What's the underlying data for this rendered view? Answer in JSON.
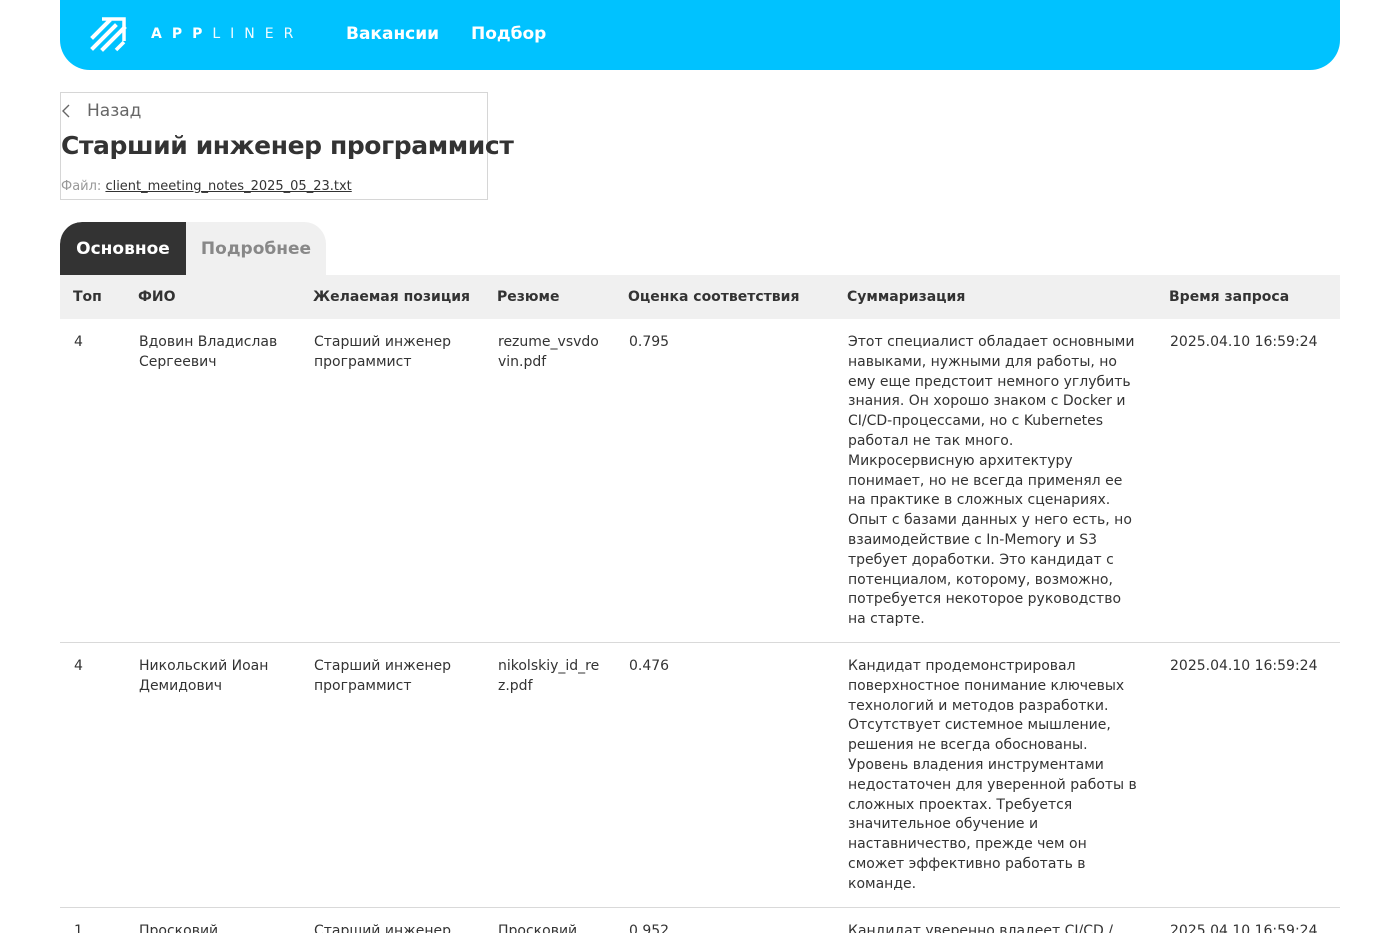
{
  "header": {
    "brand_bold": "APP",
    "brand_light": "LINER",
    "nav": [
      "Вакансии",
      "Подбор"
    ]
  },
  "page": {
    "back_label": "Назад",
    "title": "Старший инженер программист",
    "file_label": "Файл:",
    "file_name": "client_meeting_notes_2025_05_23.txt"
  },
  "tabs": [
    "Основное",
    "Подробнее"
  ],
  "colors": {
    "accent": "#00c2ff",
    "active_tab": "#333333",
    "header_bg": "#f0f0f0"
  },
  "table": {
    "columns": [
      "Топ",
      "ФИО",
      "Желаемая позиция",
      "Резюме",
      "Оценка соответствия",
      "Суммаризация",
      "Время запроса"
    ],
    "rows": [
      {
        "top": "4",
        "name": "Вдовин Владислав Сергеевич",
        "position": "Старший инженер программист",
        "resume": "rezume_vsvdovin.pdf",
        "score": "0.795",
        "summary": "Этот специалист обладает основными навыками, нужными для работы, но ему еще предстоит немного углубить знания. Он хорошо знаком с Docker и CI/CD-процессами, но с Kubernetes работал не так много. Микросервисную архитектуру понимает, но не всегда применял ее на практике в сложных сценариях. Опыт с базами данных у него есть, но взаимодействие с In-Memory и S3 требует доработки. Это кандидат с потенциалом, которому, возможно, потребуется некоторое руководство на старте.",
        "time": "2025.04.10 16:59:24"
      },
      {
        "top": "4",
        "name": "Никольский Иоан Демидович",
        "position": "Старший инженер программист",
        "resume": "nikolskiy_id_rez.pdf",
        "score": "0.476",
        "summary": "Кандидат продемонстрировал поверхностное понимание ключевых технологий и методов разработки. Отсутствует системное мышление, решения не всегда обоснованы. Уровень владения инструментами недостаточен для уверенной работы в сложных проектах. Требуется значительное обучение и наставничество, прежде чем он сможет эффективно работать в команде.",
        "time": "2025.04.10 16:59:24"
      },
      {
        "top": "1",
        "name": "Просковий",
        "position": "Старший инженер",
        "resume": "Просковий",
        "score": "0.952",
        "summary": "Кандидат уверенно владеет CI/CD /",
        "time": "2025.04.10 16:59:24"
      }
    ]
  }
}
